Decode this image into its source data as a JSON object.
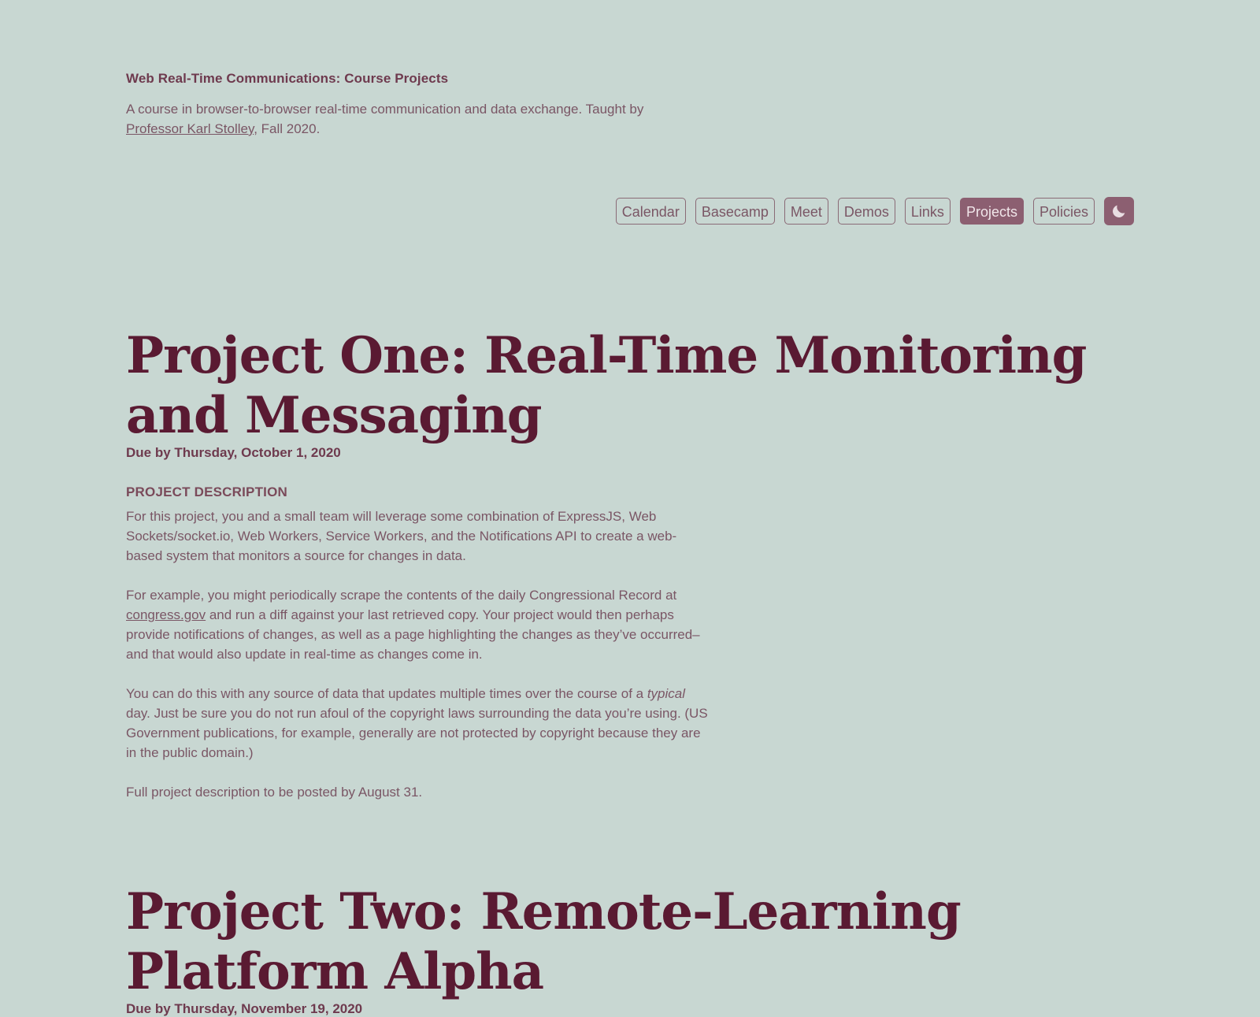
{
  "header": {
    "site_title": "Web Real-Time Communications: Course Projects",
    "description_before_link": "A course in browser-to-browser real-time communication and data exchange. Taught by ",
    "professor_link": "Professor Karl Stolley",
    "description_after_link": ", Fall 2020."
  },
  "nav": {
    "items": [
      {
        "label": "Calendar",
        "active": false
      },
      {
        "label": "Basecamp",
        "active": false
      },
      {
        "label": "Meet",
        "active": false
      },
      {
        "label": "Demos",
        "active": false
      },
      {
        "label": "Links",
        "active": false
      },
      {
        "label": "Projects",
        "active": true
      },
      {
        "label": "Policies",
        "active": false
      }
    ],
    "theme_toggle_icon": "moon-icon"
  },
  "project_one": {
    "title": "Project One: Real-Time Monitoring and Messaging",
    "due": "Due by Thursday, October 1, 2020",
    "section_heading": "PROJECT DESCRIPTION",
    "para1": "For this project, you and a small team will leverage some combination of ExpressJS, Web Sockets/socket.io, Web Workers, Service Workers, and the Notifications API to create a web-based system that monitors a source for changes in data.",
    "para2_before_link": "For example, you might periodically scrape the contents of the daily Congressional Record at ",
    "para2_link": "congress.gov",
    "para2_after_link": " and run a diff against your last retrieved copy. Your project would then perhaps provide notifications of changes, as well as a page highlighting the changes as they’ve occurred–and that would also update in real-time as changes come in.",
    "para3_before_em": "You can do this with any source of data that updates multiple times over the course of a ",
    "para3_em": "typical",
    "para3_after_em": " day. Just be sure you do not run afoul of the copyright laws surrounding the data you’re using. (US Government publications, for example, generally are not protected by copyright because they are in the public domain.)",
    "para4": "Full project description to be posted by August 31."
  },
  "project_two": {
    "title": "Project Two: Remote-Learning Platform Alpha",
    "due": "Due by Thursday, November 19, 2020"
  },
  "colors": {
    "background": "#c8d7d2",
    "heading": "#5a1a32",
    "text": "#7a5665",
    "accent": "#8c5f71"
  }
}
